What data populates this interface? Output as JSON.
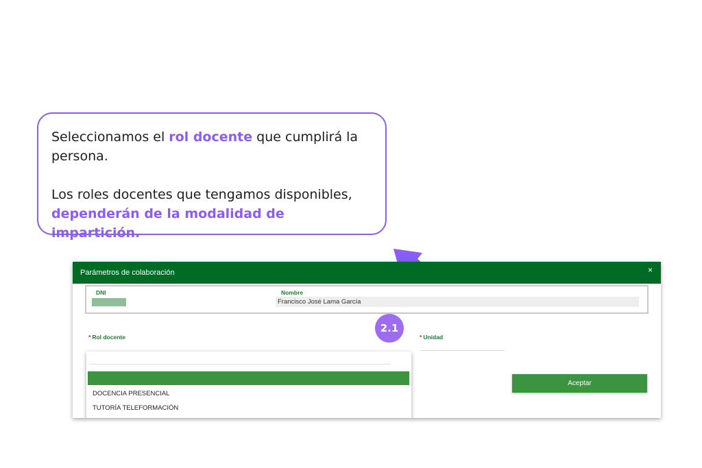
{
  "callout": {
    "line1_pre": "Seleccionamos el ",
    "line1_highlight": "rol docente",
    "line1_post": " que cumplirá la persona.",
    "line2_pre": "Los roles docentes que tengamos disponibles, ",
    "line2_highlight": "dependerán de la modalidad de impartición."
  },
  "step_badge": "2.1",
  "colors": {
    "accent_purple": "#8b5cf6",
    "header_green": "#006b24",
    "button_green": "#3d9440"
  },
  "dialog": {
    "title": "Parámetros de colaboración",
    "close_label": "×",
    "person": {
      "dni_label": "DNI",
      "name_label": "Nombre",
      "name_value": "Francisco José Lama García"
    },
    "form": {
      "required_mark": "*",
      "rol_label": "Rol docente",
      "unidad_label": "Unidad"
    },
    "dropdown": {
      "options": [
        "DOCENCIA PRESENCIAL",
        "TUTORÍA TELEFORMACIÓN"
      ]
    },
    "accept_label": "Aceptar"
  }
}
